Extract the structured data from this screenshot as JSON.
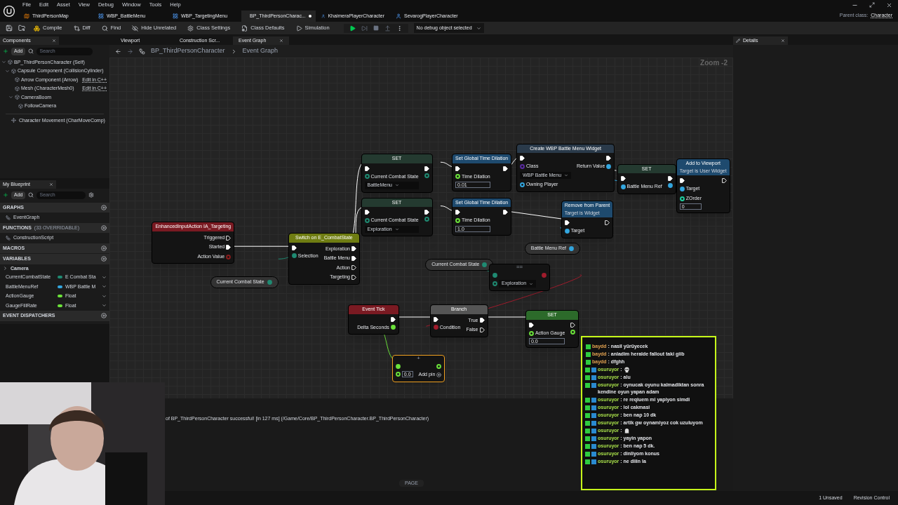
{
  "menu": [
    "File",
    "Edit",
    "Asset",
    "View",
    "Debug",
    "Window",
    "Tools",
    "Help"
  ],
  "doc_tabs": [
    {
      "label": "ThirdPersonMap",
      "kind": "level",
      "selected": false
    },
    {
      "label": "WBP_BattleMenu",
      "kind": "widget",
      "selected": false
    },
    {
      "label": "WBP_TargetingMenu",
      "kind": "widget",
      "selected": false
    },
    {
      "label": "BP_ThirdPersonCharac...",
      "kind": "blueprint",
      "selected": true,
      "modified": true
    },
    {
      "label": "KhaimeraPlayerCharacter",
      "kind": "blueprint",
      "selected": false
    },
    {
      "label": "SevarogPlayerCharacter",
      "kind": "blueprint",
      "selected": false
    }
  ],
  "parent_class": {
    "label": "Parent class:",
    "value": "Character"
  },
  "toolbar": [
    {
      "label": "Compile",
      "kind": "compile"
    },
    {
      "label": "Diff",
      "kind": "diff"
    },
    {
      "label": "Find",
      "kind": "find"
    },
    {
      "label": "Hide Unrelated",
      "kind": "hide"
    },
    {
      "label": "Class Settings",
      "kind": "settings"
    },
    {
      "label": "Class Defaults",
      "kind": "defaults"
    },
    {
      "label": "Simulation",
      "kind": "simulation"
    }
  ],
  "debug_select": "No debug object selected",
  "components": {
    "title": "Components",
    "add": "Add",
    "search_placeholder": "Search",
    "tree": [
      {
        "label": "BP_ThirdPersonCharacter (Self)",
        "children": [
          {
            "label": "Capsule Component (CollisionCylinder)",
            "children": [
              {
                "label": "Arrow Component (Arrow)",
                "link": "Edit in C++"
              },
              {
                "label": "Mesh (CharacterMesh0)",
                "link": "Edit in C++"
              },
              {
                "label": "CameraBoom",
                "children": [
                  {
                    "label": "FollowCamera"
                  }
                ]
              }
            ]
          }
        ]
      }
    ],
    "extra": "Character Movement (CharMoveComp)"
  },
  "my_blueprint": {
    "title": "My Blueprint",
    "add": "Add",
    "search_placeholder": "Search",
    "sections": [
      {
        "title": "GRAPHS",
        "items": [
          {
            "label": "EventGraph"
          }
        ]
      },
      {
        "title": "FUNCTIONS",
        "note": "(33 OVERRIDABLE)",
        "items": [
          {
            "label": "ConstructionScript"
          }
        ]
      },
      {
        "title": "MACROS"
      },
      {
        "title": "VARIABLES",
        "category": "Camera",
        "variables": [
          {
            "name": "CurrentCombatState",
            "type": "E Combat Sta",
            "color": "#1f8a72"
          },
          {
            "name": "BattleMenuRef",
            "type": "WBP Battle M",
            "color": "#33a7e0"
          },
          {
            "name": "ActionGauge",
            "type": "Float",
            "color": "#6be23a"
          },
          {
            "name": "GaugeFillRate",
            "type": "Float",
            "color": "#6be23a"
          }
        ]
      },
      {
        "title": "EVENT DISPATCHERS"
      }
    ]
  },
  "graph_tabs": [
    {
      "label": "Viewport",
      "selected": false
    },
    {
      "label": "Construction Scr...",
      "selected": false
    },
    {
      "label": "Event Graph",
      "selected": true
    }
  ],
  "breadcrumb": [
    "BP_ThirdPersonCharacter",
    "Event Graph"
  ],
  "zoom": "Zoom -2",
  "details": {
    "title": "Details"
  },
  "nodes": [
    {
      "kind": "event",
      "title": "EnhancedInputAction IA_Targeting",
      "selected": false,
      "outputs": [
        {
          "label": "Triggered",
          "kind": "exec",
          "connected": false
        },
        {
          "label": "Started",
          "kind": "exec",
          "connected": true
        },
        {
          "label": "Action Value",
          "kind": "data",
          "color": "#8a1c1c",
          "connected": false
        }
      ]
    },
    {
      "kind": "getter",
      "title": "Current Combat State",
      "color": "#1f8a72",
      "selected": false
    },
    {
      "kind": "switch",
      "title": "Switch on E_CombatState",
      "selected": false,
      "inputs": [
        {
          "kind": "exec",
          "connected": true
        },
        {
          "label": "Selection",
          "kind": "data",
          "color": "#1f8a72",
          "connected": true
        }
      ],
      "outputs": [
        {
          "label": "Exploration",
          "kind": "exec",
          "connected": true
        },
        {
          "label": "Battle Menu",
          "kind": "exec",
          "connected": true
        },
        {
          "label": "Action",
          "kind": "exec",
          "connected": false
        },
        {
          "label": "Targeting",
          "kind": "exec",
          "connected": false
        }
      ]
    },
    {
      "kind": "set",
      "title": "SET",
      "selected": false,
      "inputs": [
        {
          "kind": "exec",
          "connected": true
        },
        {
          "label": "Current Combat State",
          "kind": "data",
          "color": "#1f8a72",
          "connected": false,
          "value": "BattleMenu",
          "dropdown": true
        }
      ],
      "outputs": [
        {
          "kind": "exec",
          "connected": true
        },
        {
          "kind": "data",
          "color": "#1f8a72",
          "connected": false
        }
      ]
    },
    {
      "kind": "set",
      "title": "SET",
      "selected": false,
      "inputs": [
        {
          "kind": "exec",
          "connected": true
        },
        {
          "label": "Current Combat State",
          "kind": "data",
          "color": "#1f8a72",
          "connected": false,
          "value": "Exploration",
          "dropdown": true
        }
      ],
      "outputs": [
        {
          "kind": "exec",
          "connected": true
        },
        {
          "kind": "data",
          "color": "#1f8a72",
          "connected": false
        }
      ]
    },
    {
      "kind": "function",
      "title": "Set Global Time Dilation",
      "selected": false,
      "inputs": [
        {
          "kind": "exec",
          "connected": true
        },
        {
          "label": "Time Dilation",
          "kind": "data",
          "color": "#6be23a",
          "connected": false,
          "value": "0.01",
          "dropdown": false
        }
      ],
      "outputs": [
        {
          "kind": "exec",
          "connected": true
        }
      ]
    },
    {
      "kind": "function",
      "title": "Set Global Time Dilation",
      "selected": false,
      "inputs": [
        {
          "kind": "exec",
          "connected": true
        },
        {
          "label": "Time Dilation",
          "kind": "data",
          "color": "#6be23a",
          "connected": false,
          "value": "1.0",
          "dropdown": false
        }
      ],
      "outputs": [
        {
          "kind": "exec",
          "connected": true
        }
      ]
    },
    {
      "kind": "widget",
      "title": "Create WBP Battle Menu Widget",
      "selected": false,
      "inputs": [
        {
          "kind": "exec",
          "connected": true
        },
        {
          "label": "Class",
          "kind": "data",
          "color": "#5a2ba0",
          "connected": false,
          "value": "WBP Battle Menu",
          "dropdown": true
        },
        {
          "label": "Owning Player",
          "kind": "data",
          "color": "#33a7e0",
          "connected": false
        }
      ],
      "outputs": [
        {
          "kind": "exec",
          "connected": true
        },
        {
          "label": "Return Value",
          "kind": "data",
          "color": "#33a7e0",
          "connected": true
        }
      ]
    },
    {
      "kind": "set",
      "title": "SET",
      "selected": false,
      "inputs": [
        {
          "kind": "exec",
          "connected": true
        },
        {
          "label": "Battle Menu Ref",
          "kind": "data",
          "color": "#33a7e0",
          "connected": true
        }
      ],
      "outputs": [
        {
          "kind": "exec",
          "connected": true
        },
        {
          "kind": "data",
          "color": "#33a7e0",
          "connected": true
        }
      ]
    },
    {
      "kind": "function",
      "title": "Add to Viewport",
      "subtitle": "Target is User Widget",
      "selected": false,
      "inputs": [
        {
          "kind": "exec",
          "connected": true
        },
        {
          "label": "Target",
          "kind": "data",
          "color": "#33a7e0",
          "connected": true
        },
        {
          "label": "ZOrder",
          "kind": "data",
          "color": "#1fd0a0",
          "connected": false,
          "value": "0",
          "dropdown": false
        }
      ],
      "outputs": [
        {
          "kind": "exec",
          "connected": false
        }
      ]
    },
    {
      "kind": "getter",
      "title": "Battle Menu Ref",
      "color": "#33a7e0",
      "selected": false
    },
    {
      "kind": "function",
      "title": "Remove from Parent",
      "subtitle": "Target is Widget",
      "selected": false,
      "inputs": [
        {
          "kind": "exec",
          "connected": true
        },
        {
          "label": "Target",
          "kind": "data",
          "color": "#33a7e0",
          "connected": true
        }
      ],
      "outputs": [
        {
          "kind": "exec",
          "connected": false
        }
      ]
    },
    {
      "kind": "getter",
      "title": "Current Combat State",
      "color": "#1f8a72",
      "selected": false
    },
    {
      "kind": "compact",
      "title": "==",
      "selected": false,
      "inputs": [
        {
          "kind": "data",
          "color": "#1f8a72",
          "connected": true
        },
        {
          "kind": "data",
          "color": "#1f8a72",
          "connected": false,
          "value": "Exploration",
          "dropdown": true
        }
      ],
      "outputs": [
        {
          "kind": "data",
          "color": "#a01c2c",
          "connected": true
        }
      ]
    },
    {
      "kind": "event",
      "title": "Event Tick",
      "selected": false,
      "outputs": [
        {
          "kind": "exec",
          "connected": true
        },
        {
          "label": "Delta Seconds",
          "kind": "data",
          "color": "#6be23a",
          "connected": true
        }
      ]
    },
    {
      "kind": "branch",
      "title": "Branch",
      "selected": false,
      "inputs": [
        {
          "kind": "exec",
          "connected": true
        },
        {
          "label": "Condition",
          "kind": "data",
          "color": "#a01c2c",
          "connected": true
        }
      ],
      "outputs": [
        {
          "label": "True",
          "kind": "exec",
          "connected": true
        },
        {
          "label": "False",
          "kind": "exec",
          "connected": false
        }
      ]
    },
    {
      "kind": "setgreen",
      "title": "SET",
      "selected": false,
      "inputs": [
        {
          "kind": "exec",
          "connected": true
        },
        {
          "label": "Action Gauge",
          "kind": "data",
          "color": "#6be23a",
          "connected": false,
          "value": "0.0",
          "dropdown": false
        }
      ],
      "outputs": [
        {
          "kind": "exec",
          "connected": false
        },
        {
          "kind": "data",
          "color": "#6be23a",
          "connected": false
        }
      ]
    },
    {
      "kind": "compact",
      "title": "+",
      "selected": true,
      "inputs": [
        {
          "kind": "data",
          "color": "#6be23a",
          "connected": true
        },
        {
          "kind": "data",
          "color": "#6be23a",
          "connected": false,
          "value": "0.0",
          "dropdown": false
        }
      ],
      "outputs": [
        {
          "kind": "data",
          "color": "#6be23a",
          "connected": false
        },
        {
          "label": "Add pin",
          "kind": "add"
        }
      ]
    }
  ],
  "log": "of BP_ThirdPersonCharacter successful! [in 127 ms] (/Game/Core/BP_ThirdPersonCharacter.BP_ThirdPersonCharacter)",
  "page_button": "PAGE",
  "chat": [
    {
      "user": "baydd",
      "color": "#e0a050",
      "subscriber": false,
      "kind": "text",
      "text": ": nasil yürüyecek"
    },
    {
      "user": "baydd",
      "color": "#e0a050",
      "subscriber": false,
      "kind": "text",
      "text": ": anladim heralde fallout taki giib"
    },
    {
      "user": "baydd",
      "color": "#e0a050",
      "subscriber": false,
      "kind": "text",
      "text": ": dfghh"
    },
    {
      "user": "osuruyor",
      "color": "#a8e04a",
      "subscriber": true,
      "kind": "skull",
      "text": ":"
    },
    {
      "user": "osuruyor",
      "color": "#a8e04a",
      "subscriber": true,
      "kind": "text",
      "text": ": alu"
    },
    {
      "user": "osuruyor",
      "color": "#a8e04a",
      "subscriber": true,
      "kind": "text",
      "text": ": oynucak oyunu kalmadiktan sonra kendine oyun yapan adam"
    },
    {
      "user": "osuruyor",
      "color": "#a8e04a",
      "subscriber": true,
      "kind": "text",
      "text": ": re reqiuem mi yapiyon simdi"
    },
    {
      "user": "osuruyor",
      "color": "#a8e04a",
      "subscriber": true,
      "kind": "text",
      "text": ": lol cakmasi"
    },
    {
      "user": "osuruyor",
      "color": "#a8e04a",
      "subscriber": true,
      "kind": "text",
      "text": ": ben nap 10 dk"
    },
    {
      "user": "osuruyor",
      "color": "#a8e04a",
      "subscriber": true,
      "kind": "text",
      "text": ": artik gw oynamiyoz cok uzuluyom"
    },
    {
      "user": "osuruyor",
      "color": "#a8e04a",
      "subscriber": true,
      "kind": "ghost",
      "text": ":"
    },
    {
      "user": "osuruyor",
      "color": "#a8e04a",
      "subscriber": true,
      "kind": "text",
      "text": ": yayin yapon"
    },
    {
      "user": "osuruyor",
      "color": "#a8e04a",
      "subscriber": true,
      "kind": "text",
      "text": ": ben nap 5 dk."
    },
    {
      "user": "osuruyor",
      "color": "#a8e04a",
      "subscriber": true,
      "kind": "text",
      "text": ": dinliyom konus"
    },
    {
      "user": "osuruyor",
      "color": "#a8e04a",
      "subscriber": true,
      "kind": "text",
      "text": ": ne diiin la"
    }
  ],
  "status": {
    "unsaved": "1 Unsaved",
    "revision": "Revision Control"
  },
  "webcam": {
    "kind": "picture"
  }
}
